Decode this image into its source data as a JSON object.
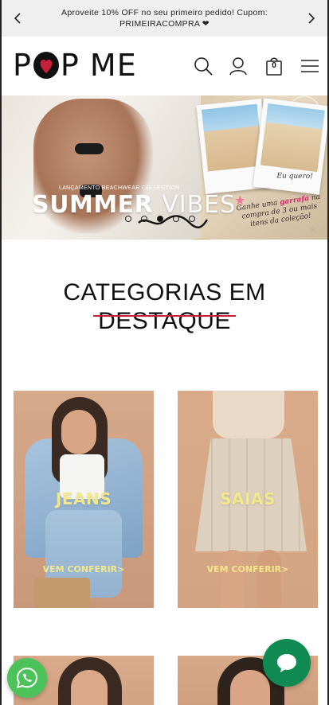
{
  "announcement": {
    "message": "Aproveite 10% OFF no seu primeiro pedido! Cupom: PRIMEIRACOMPRA ❤",
    "prev_icon": "chevron-left-icon",
    "next_icon": "chevron-right-icon"
  },
  "header": {
    "logo_left": "P",
    "logo_middle": "P ME",
    "icons": [
      "search-icon",
      "user-icon",
      "cart-icon",
      "menu-icon"
    ],
    "cart_count": "0"
  },
  "banner": {
    "subtag": "LANÇAMENTO BEACHWEAR COLLECTION",
    "title_bold": "SUMMER ",
    "title_light": "VIBES",
    "polaroid_caption": "Eu quero!",
    "promo_line1": "Ganhe uma ",
    "promo_highlight": "garrafa",
    "promo_line2": " na compra de 3 ou mais itens da coleção!",
    "slide_count": 5,
    "active_slide": 3
  },
  "section": {
    "title_line1": "CATEGORIAS EM",
    "title_line2": "DESTAQUE"
  },
  "categories": [
    {
      "label": "JEANS",
      "cta": "VEM CONFERIR>"
    },
    {
      "label": "SAIAS",
      "cta": "VEM CONFERIR>"
    }
  ],
  "floating": {
    "chat_icon": "chat-bubble-icon",
    "whatsapp_icon": "whatsapp-icon"
  },
  "colors": {
    "announcement_bg": "#efefef",
    "accent_red": "#c51f3a",
    "category_label": "#f2e78b",
    "chat_green": "#0f8a52",
    "whatsapp_green": "#4cc25a"
  }
}
